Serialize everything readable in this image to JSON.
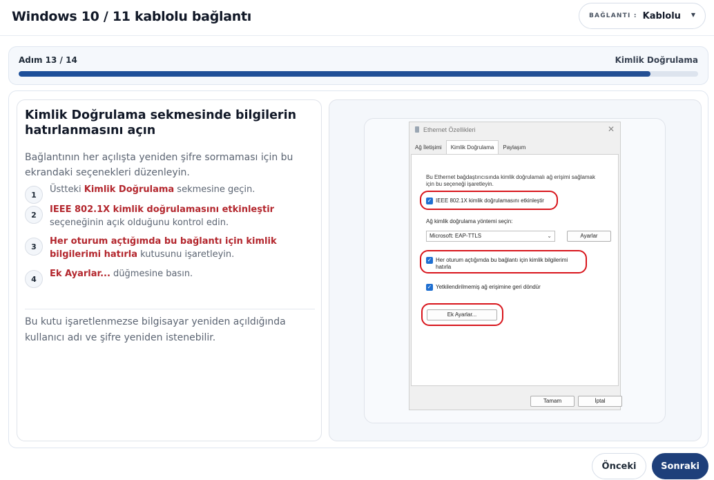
{
  "header": {
    "title": "Windows 10 / 11 kablolu bağlantı",
    "connection_label": "BAĞLANTI :",
    "connection_value": "Kablolu"
  },
  "progress": {
    "step_label": "Adım 13 / 14",
    "step_name": "Kimlik Doğrulama",
    "fraction": 0.93
  },
  "instructions": {
    "heading": "Kimlik Doğrulama sekmesinde bilgilerin hatırlanmasını açın",
    "intro": "Bağlantının her açılışta yeniden şifre sormaması için bu ekrandaki seçenekleri düzenleyin.",
    "steps": [
      {
        "num": "1",
        "pre": "Üstteki ",
        "highlight": "Kimlik Doğrulama",
        "post": " sekmesine geçin."
      },
      {
        "num": "2",
        "pre": "",
        "highlight": "IEEE 802.1X kimlik doğrulamasını etkinleştir",
        "post": " seçeneğinin açık olduğunu kontrol edin."
      },
      {
        "num": "3",
        "pre": "",
        "highlight": "Her oturum açtığımda bu bağlantı için kimlik bilgilerimi hatırla",
        "post": " kutusunu işaretleyin."
      },
      {
        "num": "4",
        "pre": "",
        "highlight": "Ek Ayarlar...",
        "post": " düğmesine basın."
      }
    ],
    "note": "Bu kutu işaretlenmezse bilgisayar yeniden açıldığında kullanıcı adı ve şifre yeniden istenebilir."
  },
  "dialog": {
    "title": "Ethernet Özellikleri",
    "close": "✕",
    "tabs": [
      "Ağ İletişimi",
      "Kimlik Doğrulama",
      "Paylaşım"
    ],
    "active_tab": "Kimlik Doğrulama",
    "description": "Bu Ethernet bağdaştırıcısında kimlik doğrulamalı ağ erişimi sağlamak için bu seçeneği işaretleyin.",
    "enable_8021x": "IEEE 802.1X kimlik doğrulamasını etkinleştir",
    "method_label": "Ağ kimlik doğrulama yöntemi seçin:",
    "method_value": "Microsoft: EAP-TTLS",
    "settings_button": "Ayarlar",
    "remember_credentials": "Her oturum açtığımda bu bağlantı için kimlik bilgilerimi hatırla",
    "fallback_unauthorized": "Yetkilendirilmemiş ağ erişimine geri döndür",
    "additional_settings_button": "Ek Ayarlar...",
    "ok_button": "Tamam",
    "cancel_button": "İptal",
    "checkmark": "✓",
    "highlight_color": "#d8141b"
  },
  "footer": {
    "prev_label": "Önceki",
    "next_label": "Sonraki"
  },
  "colors": {
    "accent": "#1e3f7a",
    "progress_fill": "#1d4f9a",
    "highlight_text": "#b3262d",
    "checkbox": "#1f6fd1"
  }
}
